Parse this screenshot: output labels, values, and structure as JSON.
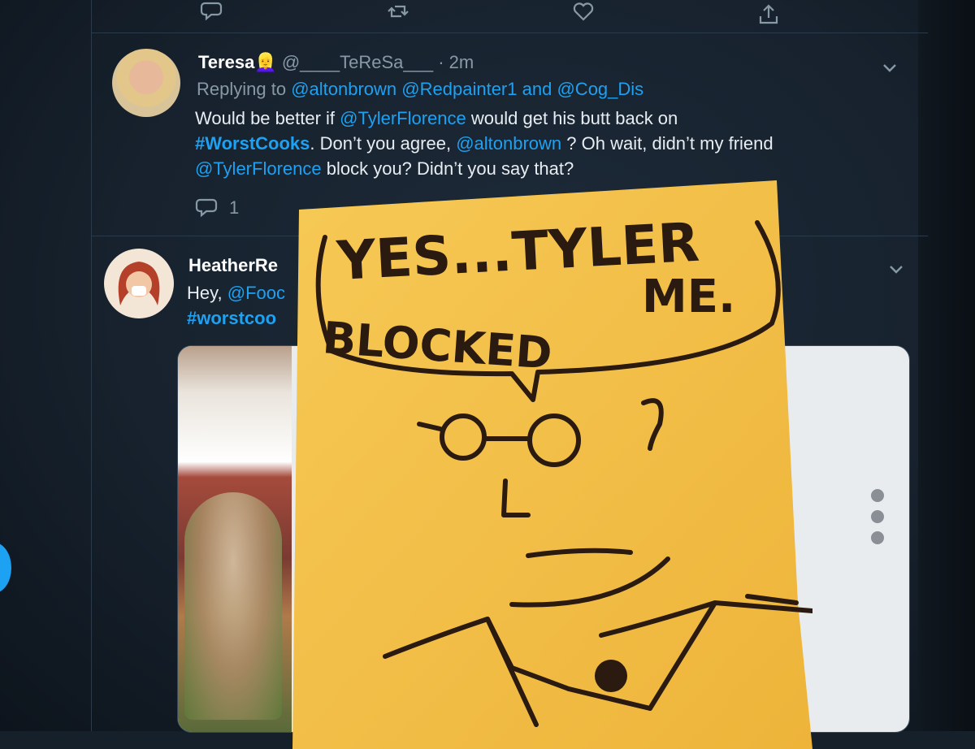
{
  "tweet1": {
    "display_name": "Teresa",
    "name_emoji": "👱‍♀️",
    "handle": "@____TeReSa___",
    "time_ago": "· 2m",
    "replying_prefix": "Replying to",
    "reply_handle_1": "@altonbrown",
    "reply_handle_2": "@Redpainter1",
    "reply_and": "and",
    "reply_handle_3": "@Cog_Dis",
    "text_1": "Would be better if",
    "mention_1": "@TylerFlorence",
    "text_2": "would get his butt back on",
    "hashtag": "#WorstCooks",
    "text_3": ".  Don’t you agree,",
    "mention_2": "@altonbrown",
    "text_4": "?  Oh wait, didn’t my friend",
    "mention_3": "@TylerFlorence",
    "text_5": "block you?  Didn’t you say that?",
    "reply_count": "1"
  },
  "tweet2": {
    "display_name_visible": "HeatherRe",
    "text_prefix": "Hey,",
    "mention_visible": "@Fooc",
    "hashtag_visible": "#worstcoo"
  },
  "sticky_note": {
    "line_1": "YES...TYLER",
    "line_2": "BLOCKED",
    "line_3": "ME."
  },
  "icons": {
    "reply": "reply-icon",
    "retweet": "retweet-icon",
    "like": "heart-icon",
    "share": "share-icon",
    "menu": "chevron-down-icon",
    "more": "more-vertical-icon"
  },
  "colors": {
    "background": "#15202b",
    "link": "#1da1f2",
    "muted": "#8899a6",
    "sticky_note": "#f3be3e",
    "ink": "#2a1a10"
  }
}
